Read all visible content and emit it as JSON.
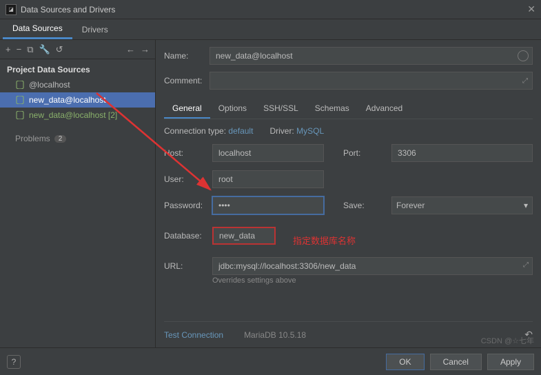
{
  "window": {
    "title": "Data Sources and Drivers"
  },
  "tabs": {
    "data_sources": "Data Sources",
    "drivers": "Drivers"
  },
  "toolbar_icons": {
    "add": "+",
    "sub": "−",
    "copy": "⧉",
    "wrench": "🔧",
    "reset": "↺",
    "back": "←",
    "fwd": "→"
  },
  "left": {
    "section": "Project Data Sources",
    "items": [
      {
        "label": "@localhost",
        "selected": false,
        "green": false
      },
      {
        "label": "new_data@localhost",
        "selected": true,
        "green": false
      },
      {
        "label": "new_data@localhost [2]",
        "selected": false,
        "green": true
      }
    ],
    "problems_label": "Problems",
    "problems_count": "2"
  },
  "form": {
    "name_label": "Name:",
    "name_value": "new_data@localhost",
    "comment_label": "Comment:"
  },
  "inner_tabs": {
    "general": "General",
    "options": "Options",
    "sshssl": "SSH/SSL",
    "schemas": "Schemas",
    "advanced": "Advanced"
  },
  "general": {
    "conn_type_label": "Connection type:",
    "conn_type_value": "default",
    "driver_label": "Driver:",
    "driver_value": "MySQL",
    "host_label": "Host:",
    "host_value": "localhost",
    "port_label": "Port:",
    "port_value": "3306",
    "user_label": "User:",
    "user_value": "root",
    "password_label": "Password:",
    "password_value": "••••",
    "save_label": "Save:",
    "save_value": "Forever",
    "database_label": "Database:",
    "database_value": "new_data",
    "url_label": "URL:",
    "url_value": "jdbc:mysql://localhost:3306/new_data",
    "override_note": "Overrides settings above"
  },
  "annotation": "指定数据库名称",
  "footer": {
    "test_connection": "Test Connection",
    "driver_version": "MariaDB 10.5.18",
    "ok": "OK",
    "cancel": "Cancel",
    "apply": "Apply"
  },
  "watermark": "CSDN @☆七年"
}
